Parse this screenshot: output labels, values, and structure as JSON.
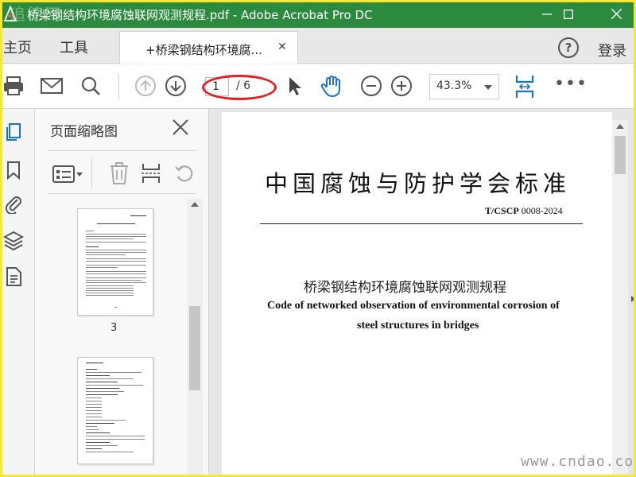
{
  "window": {
    "title": "桥梁钢结构环境腐蚀联网观测规程.pdf - Adobe Acrobat Pro DC",
    "watermark": "追德网"
  },
  "menu": {
    "home": "主页",
    "tools": "工具",
    "login": "登录",
    "help": "?"
  },
  "tab": {
    "label": "+桥梁钢结构环境腐...",
    "close": "✕"
  },
  "toolbar": {
    "current_page": "1",
    "total_pages": "/ 6",
    "zoom": "43.3%",
    "more": "•••"
  },
  "thumbnails": {
    "title": "页面缩略图",
    "pages": [
      {
        "number": "3"
      },
      {
        "number": ""
      }
    ]
  },
  "document": {
    "heading": "中国腐蚀与防护学会标准",
    "code_prefix": "T/CSCP",
    "code_number": "0008-2024",
    "title_cn": "桥梁钢结构环境腐蚀联网观测规程",
    "title_en_line1": "Code of networked observation of environmental corrosion of",
    "title_en_line2": "steel structures in bridges"
  },
  "footer": {
    "site": "www.cndao.com"
  },
  "colors": {
    "titlebar": "#2b8a3e",
    "frame": "#f5e733",
    "accent_blue": "#1a73c8",
    "highlight_red": "#e02020"
  }
}
